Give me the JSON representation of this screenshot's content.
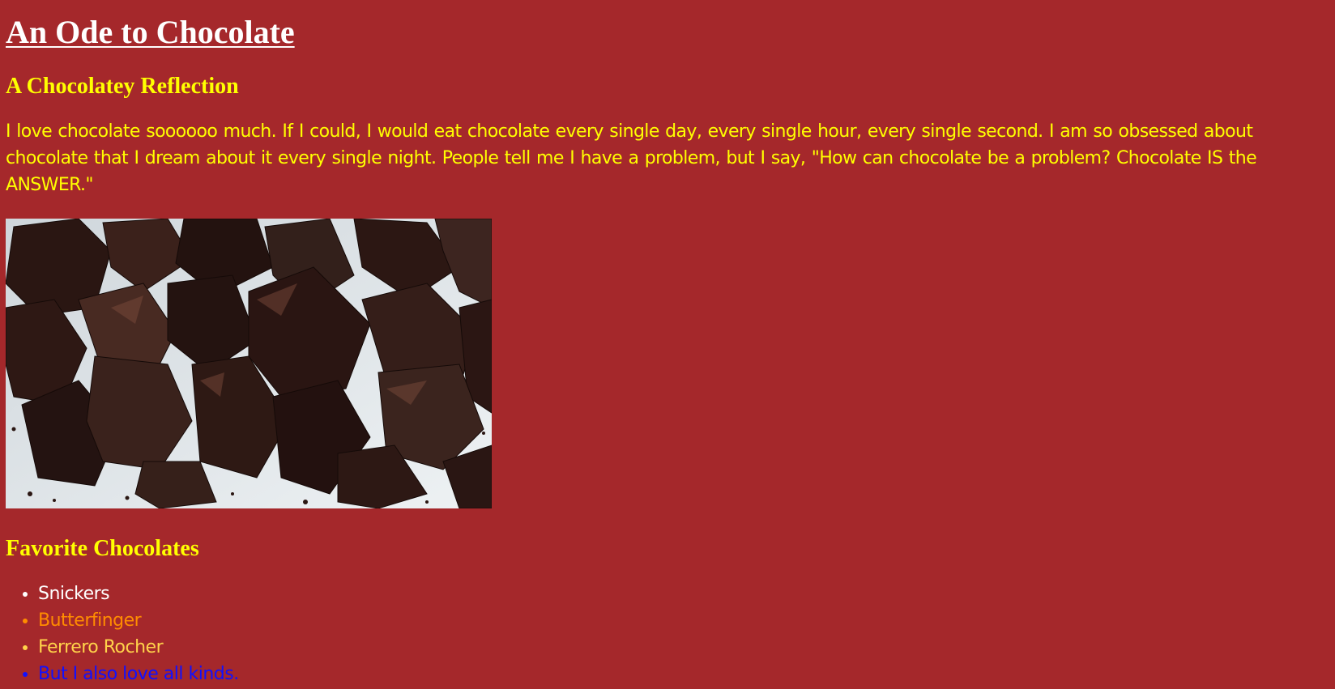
{
  "page": {
    "title": "An Ode to Chocolate",
    "reflection_heading": "A Chocolatey Reflection",
    "reflection_text": "I love chocolate soooooo much. If I could, I would eat chocolate every single day, every single hour, every single second. I am so obsessed about chocolate that I dream about it every single night. People tell me I have a problem, but I say, \"How can chocolate be a problem? Chocolate IS the ANSWER.\"",
    "image_icon": "chocolate-pieces-photo",
    "favorites_heading": "Favorite Chocolates",
    "favorites": [
      {
        "label": "Snickers",
        "color": "#ffffff"
      },
      {
        "label": "Butterfinger",
        "color": "#ff8c00"
      },
      {
        "label": "Ferrero Rocher",
        "color": "#ffd24a"
      },
      {
        "label": "But I also love all kinds.",
        "color": "#1010ff"
      }
    ]
  },
  "colors": {
    "background": "#a5282b",
    "heading_yellow": "#ffff00",
    "title_white": "#ffffff"
  }
}
